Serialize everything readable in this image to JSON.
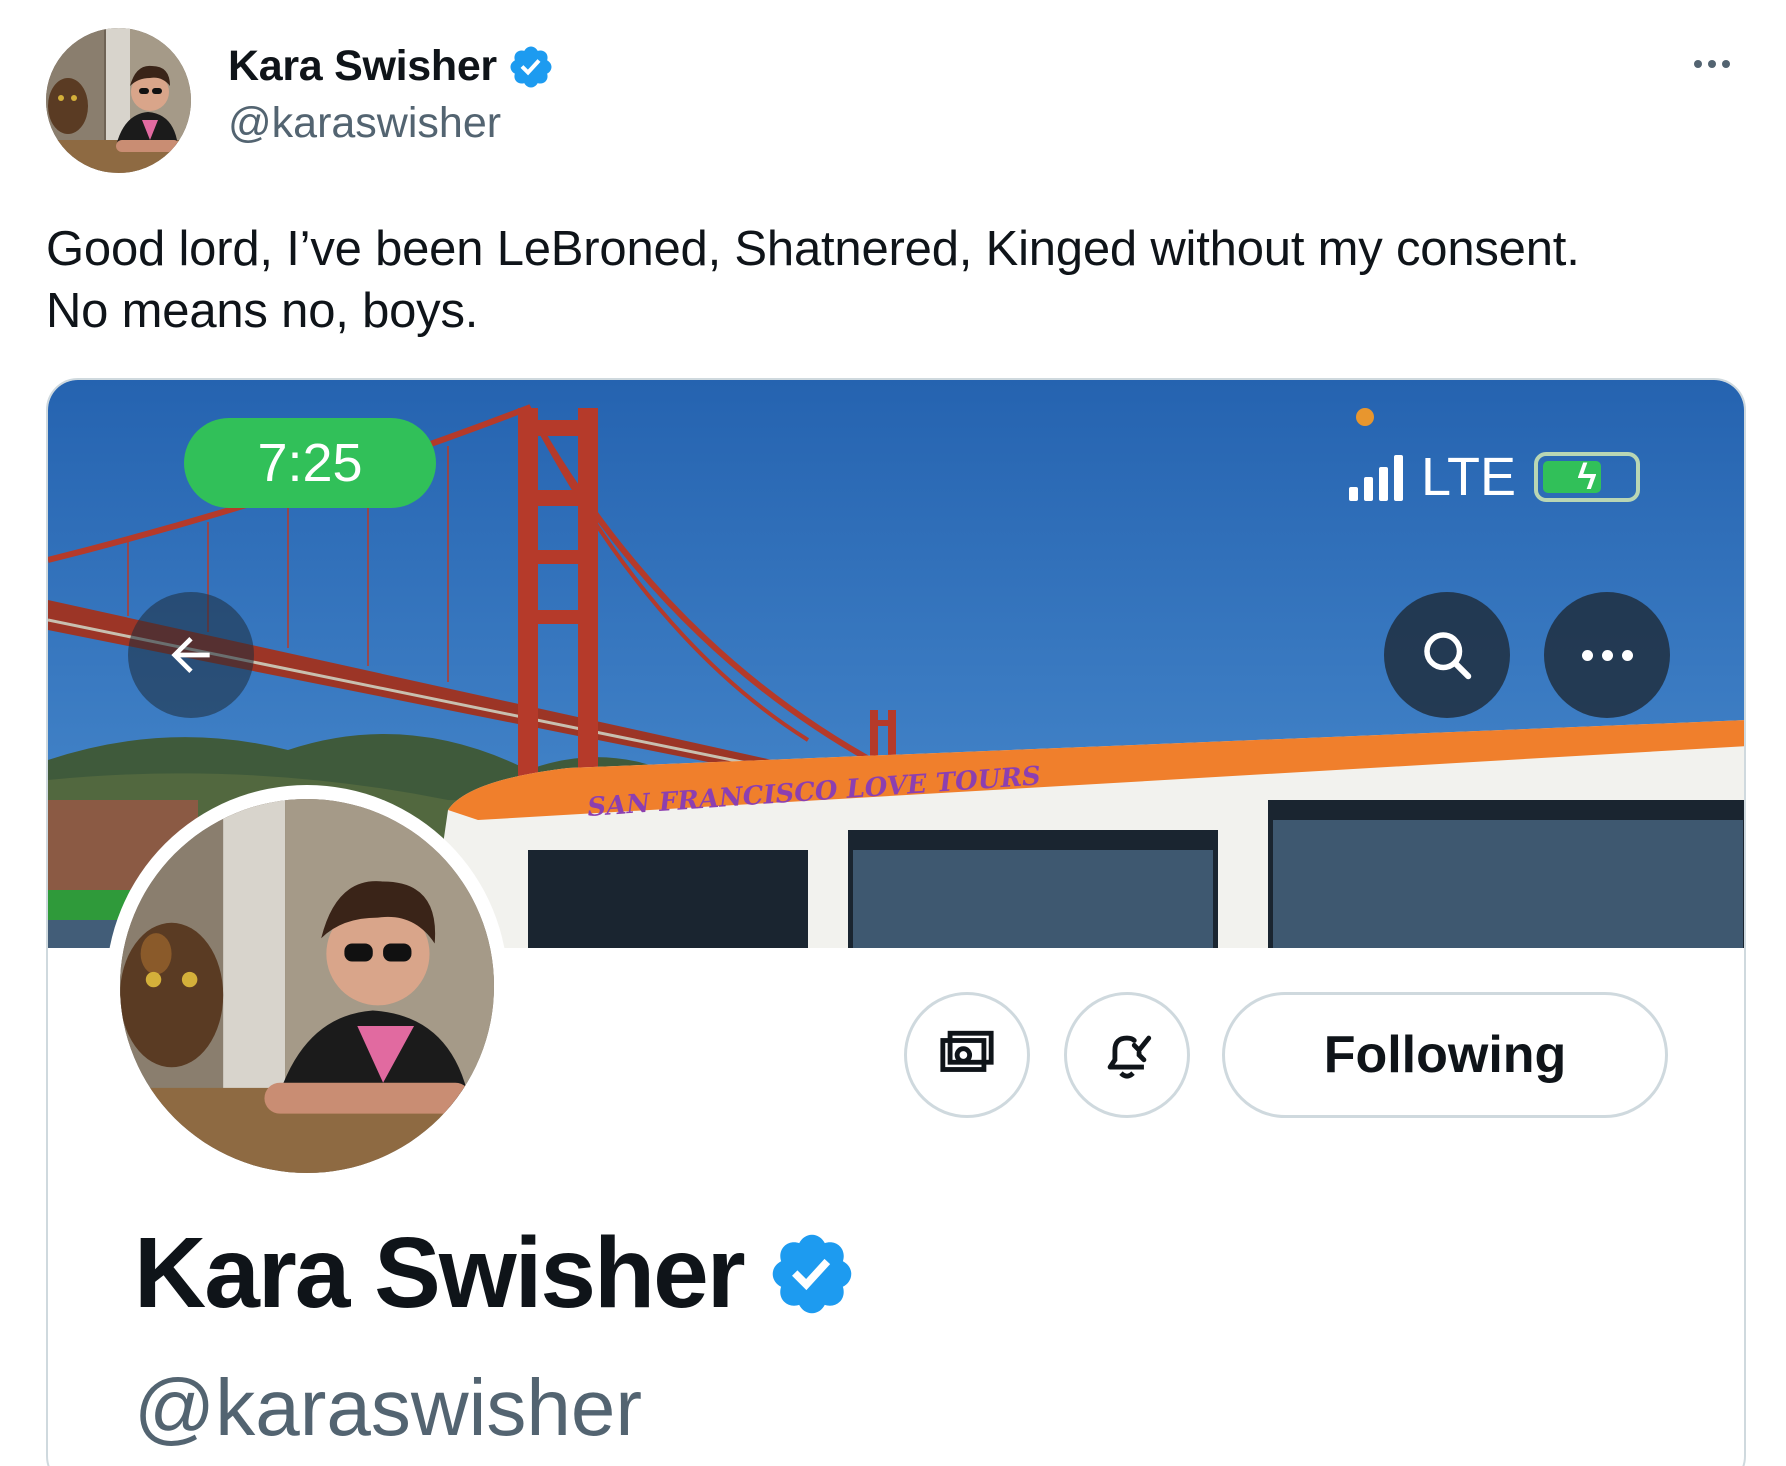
{
  "tweet": {
    "author_name": "Kara Swisher",
    "author_handle": "@karaswisher",
    "text": "Good lord, I’ve been LeBroned, Shatnered, Kinged without my consent.\nNo means no, boys."
  },
  "screenshot": {
    "status_time": "7:25",
    "network": "LTE",
    "van_lettering": "SAN FRANCISCO LOVE TOURS",
    "following_label": "Following",
    "profile_name": "Kara Swisher",
    "profile_handle": "@karaswisher"
  },
  "colors": {
    "verified": "#1d9bf0",
    "status_pill": "#31c059",
    "sky": "#2f6db3",
    "bridge": "#b53a2a",
    "van_roof": "#f07f2c"
  },
  "icons": [
    "verified-badge-icon",
    "more-icon",
    "back-arrow-icon",
    "search-icon",
    "money-icon",
    "bell-check-icon"
  ]
}
